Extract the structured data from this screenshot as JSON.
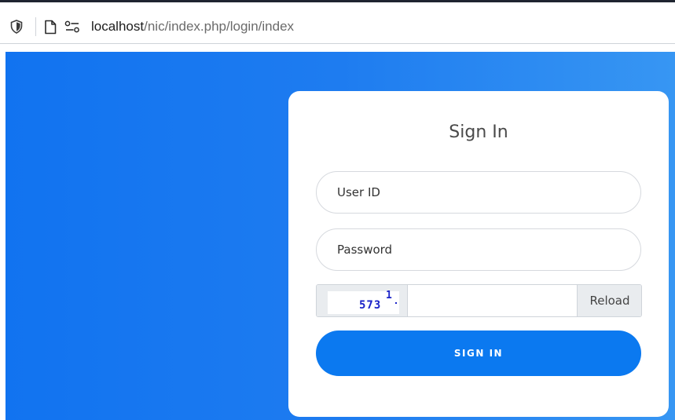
{
  "browser": {
    "url_host": "localhost",
    "url_path": "/nic/index.php/login/index",
    "icons": [
      "shield-icon",
      "page-icon",
      "permissions-icon"
    ]
  },
  "background": {
    "gradient_start": "#1173f0",
    "gradient_end": "#3796f3"
  },
  "login": {
    "title": "Sign In",
    "user_id_placeholder": "User ID",
    "password_placeholder": "Password",
    "captcha_text": "573",
    "captcha_sup": "1",
    "captcha_input_value": "",
    "reload_label": "Reload",
    "signin_label": "SIGN IN",
    "accent_color": "#0b79f0"
  }
}
